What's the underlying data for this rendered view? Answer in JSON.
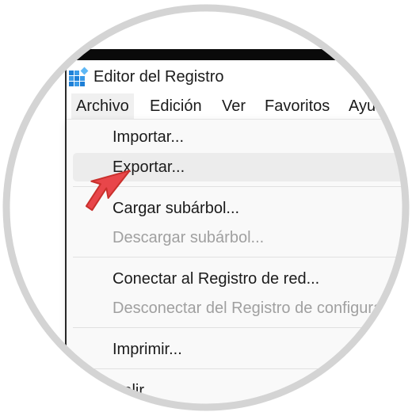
{
  "window": {
    "title": "Editor del Registro",
    "icon": "registry-editor-icon"
  },
  "menubar": {
    "items": [
      {
        "label": "Archivo",
        "active": true
      },
      {
        "label": "Edición",
        "active": false
      },
      {
        "label": "Ver",
        "active": false
      },
      {
        "label": "Favoritos",
        "active": false
      },
      {
        "label": "Ayuda",
        "active": false
      }
    ]
  },
  "dropdown": {
    "items": [
      {
        "label": "Importar...",
        "disabled": false,
        "hover": false
      },
      {
        "label": "Exportar...",
        "disabled": false,
        "hover": true
      },
      {
        "label": "Cargar subárbol...",
        "disabled": false,
        "hover": false
      },
      {
        "label": "Descargar subárbol...",
        "disabled": true,
        "hover": false
      },
      {
        "label": "Conectar al Registro de red...",
        "disabled": false,
        "hover": false
      },
      {
        "label": "Desconectar del Registro de configuración...",
        "disabled": true,
        "hover": false
      },
      {
        "label": "Imprimir...",
        "disabled": false,
        "hover": false
      },
      {
        "label": "Salir",
        "disabled": false,
        "hover": false
      }
    ]
  },
  "colors": {
    "cursor": "#e8464a",
    "icon_blue": "#1e7fd6",
    "disabled_text": "#a0a0a0"
  }
}
